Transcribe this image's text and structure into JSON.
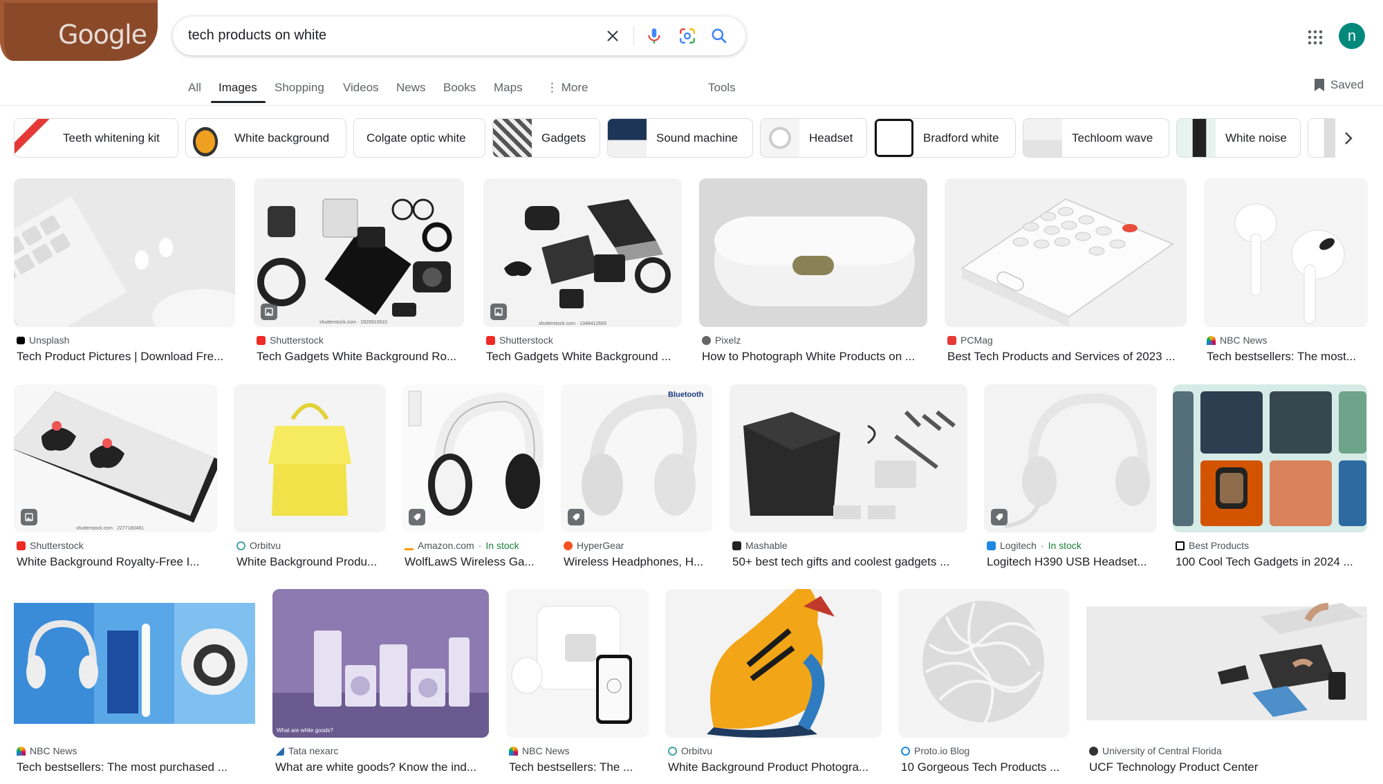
{
  "header": {
    "logo_text": "Google",
    "search_query": "tech products on white",
    "avatar_letter": "n"
  },
  "tabs": [
    "All",
    "Images",
    "Shopping",
    "Videos",
    "News",
    "Books",
    "Maps",
    "More",
    "Tools"
  ],
  "saved_label": "Saved",
  "chips": [
    "Teeth whitening kit",
    "White background",
    "Colgate optic white",
    "Gadgets",
    "Sound machine",
    "Headset",
    "Bradford white",
    "Techloom wave",
    "White noise"
  ],
  "results": [
    {
      "source": "Unsplash",
      "title": "Tech Product Pictures | Download Fre..."
    },
    {
      "source": "Shutterstock",
      "title": "Tech Gadgets White Background Ro..."
    },
    {
      "source": "Shutterstock",
      "title": "Tech Gadgets White Background ..."
    },
    {
      "source": "Pixelz",
      "title": "How to Photograph White Products on ..."
    },
    {
      "source": "PCMag",
      "title": "Best Tech Products and Services of 2023 ..."
    },
    {
      "source": "NBC News",
      "title": "Tech bestsellers: The most..."
    },
    {
      "source": "Shutterstock",
      "title": "White Background Royalty-Free I..."
    },
    {
      "source": "Orbitvu",
      "title": "White Background Produ..."
    },
    {
      "source": "Amazon.com",
      "stock": "In stock",
      "title": "WolfLawS Wireless Ga..."
    },
    {
      "source": "HyperGear",
      "title": "Wireless Headphones, H..."
    },
    {
      "source": "Mashable",
      "title": "50+ best tech gifts and coolest gadgets ..."
    },
    {
      "source": "Logitech",
      "stock": "In stock",
      "title": "Logitech H390 USB Headset..."
    },
    {
      "source": "Best Products",
      "title": "100 Cool Tech Gadgets in 2024 ..."
    },
    {
      "source": "NBC News",
      "title": "Tech bestsellers: The most purchased ..."
    },
    {
      "source": "Tata nexarc",
      "title": "What are white goods? Know the ind..."
    },
    {
      "source": "NBC News",
      "title": "Tech bestsellers: The ..."
    },
    {
      "source": "Orbitvu",
      "title": "White Background Product Photogra..."
    },
    {
      "source": "Proto.io Blog",
      "title": "10 Gorgeous Tech Products ..."
    },
    {
      "source": "University of Central Florida",
      "title": "UCF Technology Product Center"
    }
  ],
  "image_text": {
    "shutterstock_1": "shutterstock.com · 1929910910",
    "shutterstock_2": "shutterstock.com · 1348412693",
    "shutterstock_3": "shutterstock.com · 2277180481",
    "bluetooth": "Bluetooth",
    "white_goods": "What are white goods?"
  }
}
